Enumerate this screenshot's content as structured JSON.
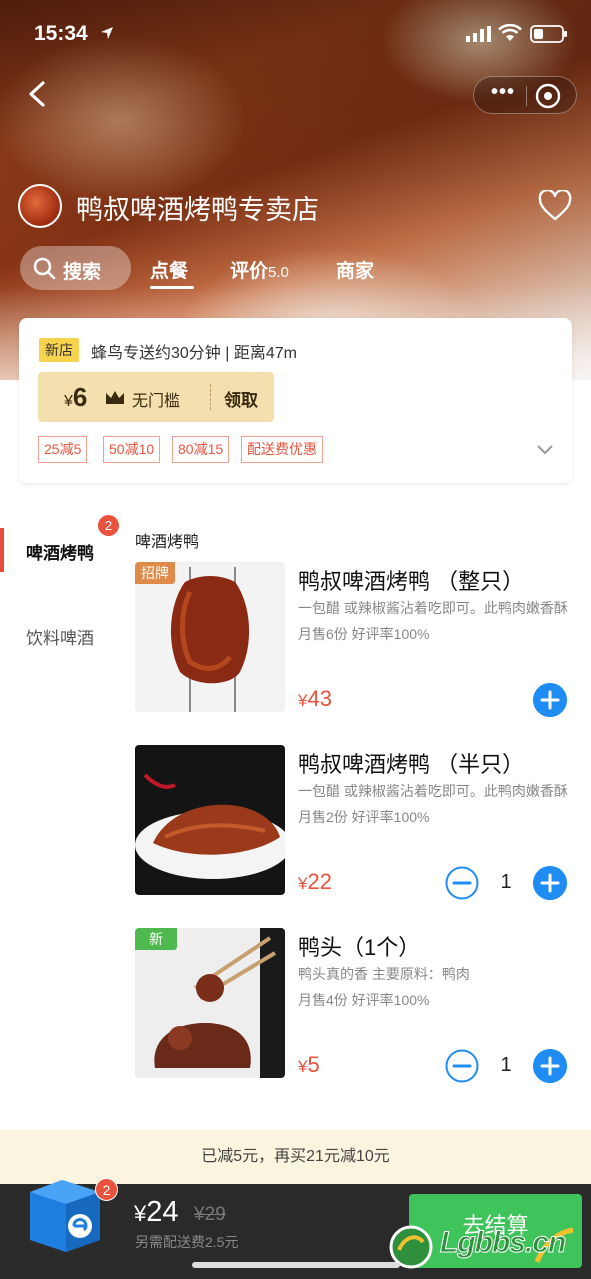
{
  "status_bar": {
    "time": "15:34"
  },
  "shop": {
    "name": "鸭叔啤酒烤鸭专卖店"
  },
  "tabs": {
    "search": "搜索",
    "order": "点餐",
    "reviews": "评价",
    "reviews_score": "5.0",
    "merchant": "商家"
  },
  "info_card": {
    "new_badge": "新店",
    "delivery": "蜂鸟专送约30分钟 | 距离47m",
    "coupon": {
      "currency": "¥",
      "amount": "6",
      "condition": "无门槛",
      "action": "领取"
    },
    "promos": [
      "25减5",
      "50减10",
      "80减15",
      "配送费优惠"
    ]
  },
  "sidebar": {
    "items": [
      {
        "label": "啤酒烤鸭",
        "badge": "2",
        "active": true
      },
      {
        "label": "饮料啤酒",
        "active": false
      }
    ]
  },
  "category": {
    "title": "啤酒烤鸭"
  },
  "menu_items": [
    {
      "tag": "招牌",
      "tag_color": "#e08a4a",
      "name": "鸭叔啤酒烤鸭 （整只）",
      "desc": "一包醋 或辣椒酱沾着吃即可。此鸭肉嫩香酥",
      "sales": "月售6份  好评率100%",
      "currency": "¥",
      "price": "43",
      "qty": null
    },
    {
      "tag": null,
      "name": "鸭叔啤酒烤鸭 （半只）",
      "desc": "一包醋 或辣椒酱沾着吃即可。此鸭肉嫩香酥",
      "sales": "月售2份  好评率100%",
      "currency": "¥",
      "price": "22",
      "qty": "1"
    },
    {
      "tag": "新",
      "tag_color": "#4fb84f",
      "name": "鸭头（1个）",
      "desc": "鸭头真的香 主要原料：鸭肉",
      "sales": "月售4份  好评率100%",
      "currency": "¥",
      "price": "5",
      "qty": "1"
    }
  ],
  "notice": "已减5元，再买21元减10元",
  "cart": {
    "badge": "2",
    "currency": "¥",
    "total": "24",
    "original": "¥29",
    "fee": "另需配送费2.5元",
    "checkout": "去结算"
  },
  "watermark": "Lgbbs.cn",
  "colors": {
    "accent_blue": "#1e8cf3",
    "accent_red": "#e9523d",
    "checkout_green": "#3fc35b"
  }
}
